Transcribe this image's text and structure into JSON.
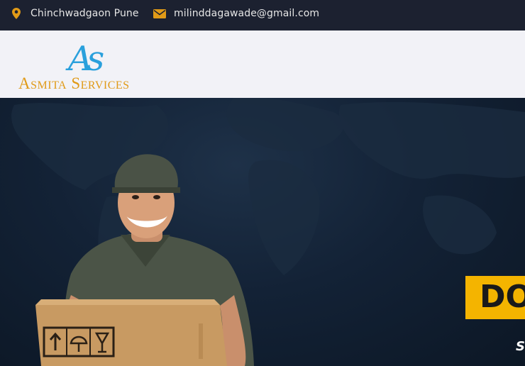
{
  "topbar": {
    "location": "Chinchwadgaon Pune",
    "location_icon": "map-marker-icon",
    "email": "milinddagawade@gmail.com",
    "email_icon": "envelope-icon",
    "icon_color": "#e09a17"
  },
  "header": {
    "logo_mark": "As",
    "logo_name": "Asmita Services",
    "brand_blue": "#2aa0dc",
    "brand_gold": "#e09a17"
  },
  "hero": {
    "badge_text": "DO",
    "badge_color": "#f4b400",
    "subtext": "S"
  }
}
